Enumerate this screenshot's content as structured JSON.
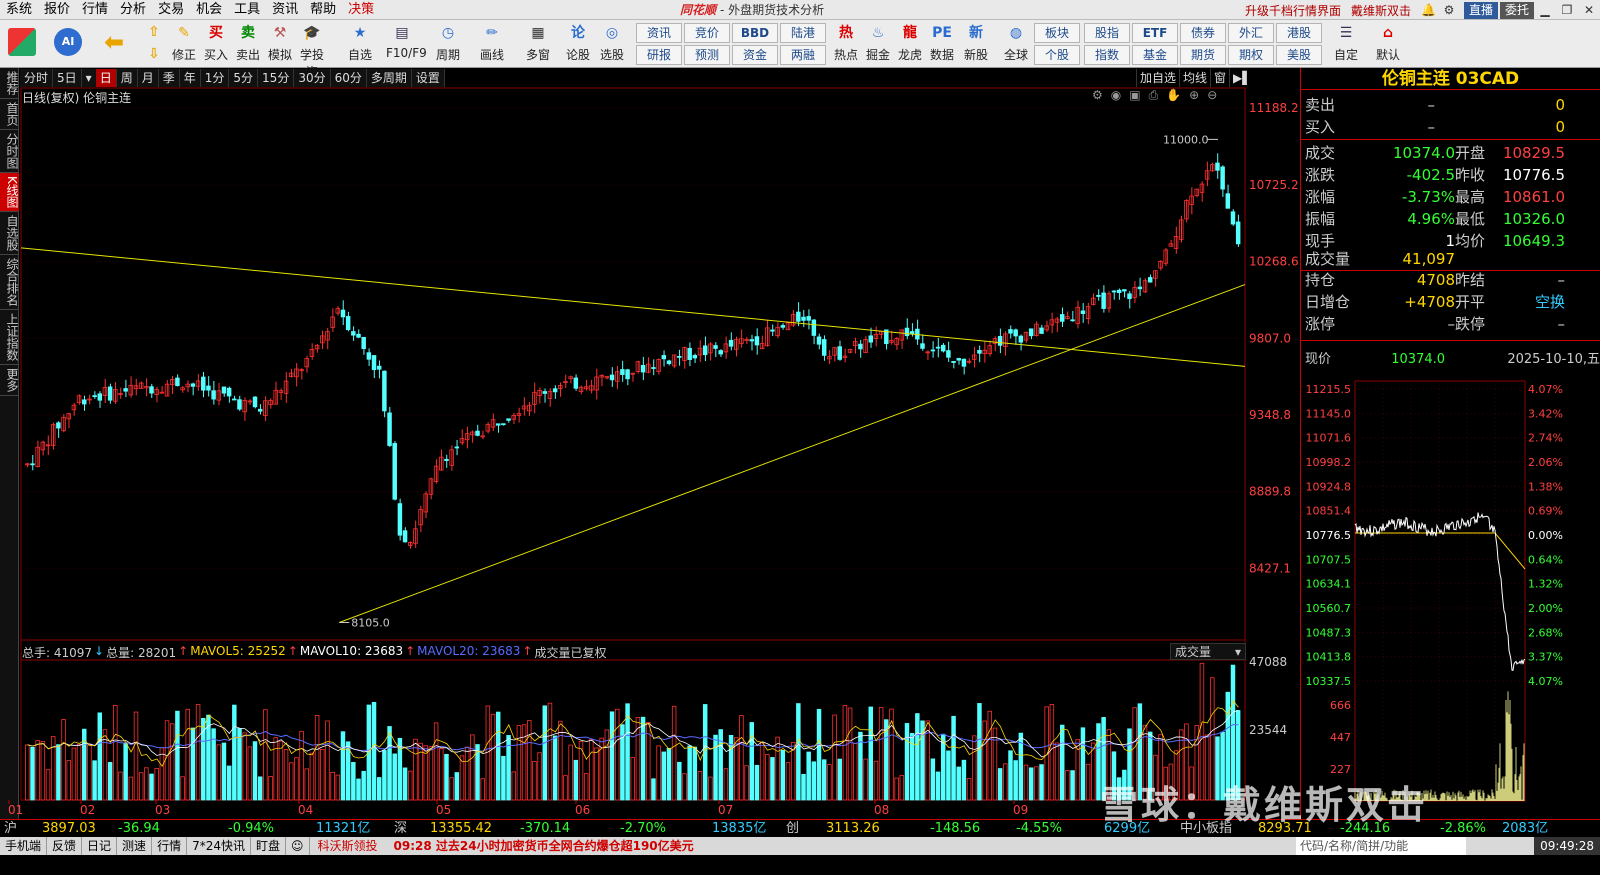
{
  "menu": {
    "items": [
      "系统",
      "报价",
      "行情",
      "分析",
      "交易",
      "机会",
      "工具",
      "资讯",
      "帮助",
      "决策"
    ],
    "brand": "同花顺",
    "window_title": "- 外盘期货技术分析",
    "upgrade": "升级千档行情界面",
    "user": "戴维斯双击",
    "live": "直播",
    "trust": "委托"
  },
  "toolbar": {
    "big_buttons": [
      {
        "label": "修正",
        "icon": "revise-icon"
      },
      {
        "label": "买入",
        "icon": "buy-icon"
      },
      {
        "label": "卖出",
        "icon": "sell-icon"
      },
      {
        "label": "模拟",
        "icon": "simulate-icon"
      },
      {
        "label": "学投资",
        "icon": "learn-icon"
      },
      {
        "label": "自选",
        "icon": "favorites-icon"
      },
      {
        "label": "F10/F9",
        "icon": "f10-icon"
      },
      {
        "label": "周期",
        "icon": "period-icon"
      },
      {
        "label": "画线",
        "icon": "draw-line-icon"
      },
      {
        "label": "多窗",
        "icon": "multi-window-icon"
      },
      {
        "label": "论股",
        "icon": "discuss-icon"
      },
      {
        "label": "选股",
        "icon": "stock-pick-icon"
      },
      {
        "label": "热点",
        "icon": "hot-icon"
      },
      {
        "label": "掘金",
        "icon": "dig-gold-icon"
      },
      {
        "label": "龙虎",
        "icon": "dragon-tiger-icon"
      },
      {
        "label": "数据",
        "icon": "data-icon"
      },
      {
        "label": "新股",
        "icon": "ipo-icon"
      },
      {
        "label": "全球",
        "icon": "globe-icon"
      },
      {
        "label": "自定",
        "icon": "custom-icon"
      },
      {
        "label": "默认",
        "icon": "home-icon"
      }
    ],
    "small_top": [
      "资讯",
      "竞价",
      "BBD",
      "陆港",
      "板块",
      "股指",
      "ETF",
      "债券",
      "外汇",
      "港股"
    ],
    "small_bottom": [
      "研报",
      "预测",
      "资金",
      "两融",
      "个股",
      "指数",
      "基金",
      "期货",
      "期权",
      "美股"
    ]
  },
  "sidebar": [
    "推荐",
    "首页",
    "分时图",
    "K线图",
    "自选股",
    "综合排名",
    "上证指数",
    "更多"
  ],
  "period_tabs": [
    "分时",
    "5日",
    "日",
    "周",
    "月",
    "季",
    "年",
    "1分",
    "5分",
    "15分",
    "30分",
    "60分",
    "多周期",
    "设置"
  ],
  "active_period": "日",
  "right_tabs": [
    "加自选",
    "均线",
    "窗"
  ],
  "chart_header": "日线(复权) 伦铜主连",
  "volume_header": {
    "total": "总手: 41097",
    "total_vol": "总量: 28201",
    "mavol5": "MAVOL5: 25252",
    "mavol10": "MAVOL10: 23683",
    "mavol20": "MAVOL20: 23683",
    "note": "成交量已复权",
    "selector": "成交量"
  },
  "chart_data": {
    "type": "candlestick",
    "instrument": "伦铜主连",
    "price_axis": [
      "11188.2",
      "10725.2",
      "10268.6",
      "9807.0",
      "9348.8",
      "8889.8",
      "8427.1"
    ],
    "price_range": [
      8000,
      11200
    ],
    "volume_axis": [
      "47088",
      "23544"
    ],
    "months": [
      "01",
      "02",
      "03",
      "04",
      "05",
      "06",
      "07",
      "08",
      "09"
    ],
    "annotations": {
      "high_label": "11000.0",
      "low_label": "8105.0"
    },
    "trendlines": [
      {
        "from": [
          0,
          10350
        ],
        "to": [
          1,
          9640
        ]
      },
      {
        "from": [
          0.26,
          8105
        ],
        "to": [
          1,
          10130
        ]
      }
    ]
  },
  "quote": {
    "title": "伦铜主连 03CAD",
    "sell": {
      "label": "卖出",
      "dash": "–",
      "value": "0"
    },
    "buy": {
      "label": "买入",
      "dash": "–",
      "value": "0"
    },
    "rows": [
      {
        "k1": "成交",
        "v1": "10374.0",
        "k2": "开盘",
        "v2": "10829.5",
        "c1": "#33ff33",
        "c2": "#ff4040"
      },
      {
        "k1": "涨跌",
        "v1": "-402.5",
        "k2": "昨收",
        "v2": "10776.5",
        "c1": "#33ff33",
        "c2": "#ffffff"
      },
      {
        "k1": "涨幅",
        "v1": "-3.73%",
        "k2": "最高",
        "v2": "10861.0",
        "c1": "#33ff33",
        "c2": "#ff4040"
      },
      {
        "k1": "振幅",
        "v1": "4.96%",
        "k2": "最低",
        "v2": "10326.0",
        "c1": "#33ff33",
        "c2": "#33ff33"
      },
      {
        "k1": "现手",
        "v1": "1",
        "k2": "均价",
        "v2": "10649.3",
        "c1": "#ffffff",
        "c2": "#33ff33"
      }
    ],
    "volume": {
      "label": "成交量",
      "value": "41,097"
    },
    "hold": [
      {
        "k1": "持仓",
        "v1": "4708",
        "k2": "昨结",
        "v2": "–",
        "c1": "#ffd700",
        "c2": "#ccc"
      },
      {
        "k1": "日增仓",
        "v1": "+4708",
        "k2": "开平",
        "v2": "空换",
        "c1": "#ffd700",
        "c2": "#33ccff"
      },
      {
        "k1": "涨停",
        "v1": "–",
        "k2": "跌停",
        "v2": "–",
        "c1": "#ccc",
        "c2": "#ccc"
      }
    ],
    "now": {
      "label": "现价",
      "value": "10374.0",
      "date": "2025-10-10,五"
    }
  },
  "mini_chart": {
    "price_ticks": [
      "11215.5",
      "11145.0",
      "11071.6",
      "10998.2",
      "10924.8",
      "10851.4",
      "10776.5",
      "10707.5",
      "10634.1",
      "10560.7",
      "10487.3",
      "10413.8",
      "10337.5"
    ],
    "pct_ticks": [
      "4.07%",
      "3.42%",
      "2.74%",
      "2.06%",
      "1.38%",
      "0.69%",
      "0.00%",
      "0.64%",
      "1.32%",
      "2.00%",
      "2.68%",
      "3.37%",
      "4.07%"
    ],
    "vol_ticks": [
      "666",
      "447",
      "227"
    ]
  },
  "index_bar": [
    {
      "text": "沪",
      "color": "#cccccc"
    },
    {
      "text": "3897.03",
      "color": "#ffd700"
    },
    {
      "text": "-36.94",
      "color": "#33ff33"
    },
    {
      "text": "-0.94%",
      "color": "#33ff33"
    },
    {
      "text": "11321亿",
      "color": "#33ccff"
    },
    {
      "text": "深",
      "color": "#cccccc"
    },
    {
      "text": "13355.42",
      "color": "#ffd700"
    },
    {
      "text": "-370.14",
      "color": "#33ff33"
    },
    {
      "text": "-2.70%",
      "color": "#33ff33"
    },
    {
      "text": "13835亿",
      "color": "#33ccff"
    },
    {
      "text": "创",
      "color": "#cccccc"
    },
    {
      "text": "3113.26",
      "color": "#ffd700"
    },
    {
      "text": "-148.56",
      "color": "#33ff33"
    },
    {
      "text": "-4.55%",
      "color": "#33ff33"
    },
    {
      "text": "6299亿",
      "color": "#33ccff"
    },
    {
      "text": "中小板指",
      "color": "#cccccc"
    },
    {
      "text": "8293.71",
      "color": "#ffd700"
    },
    {
      "text": "-244.16",
      "color": "#33ff33"
    },
    {
      "text": "-2.86%",
      "color": "#33ff33"
    },
    {
      "text": "2083亿",
      "color": "#33ccff"
    }
  ],
  "bottom": {
    "items": [
      "手机端",
      "反馈",
      "日记",
      "测速",
      "行情",
      "7*24快讯",
      "盯盘"
    ],
    "news1": "科沃斯领投",
    "news2": "09:28 过去24小时加密货币全网合约爆仓超190亿美元",
    "search": "代码/名称/简拼/功能",
    "time": "09:49:28"
  },
  "watermark": "雪球：戴维斯双击",
  "colors": {
    "up": "#ff3030",
    "down": "#54ffff",
    "accent": "#cc0000",
    "line": "#e6e600"
  }
}
